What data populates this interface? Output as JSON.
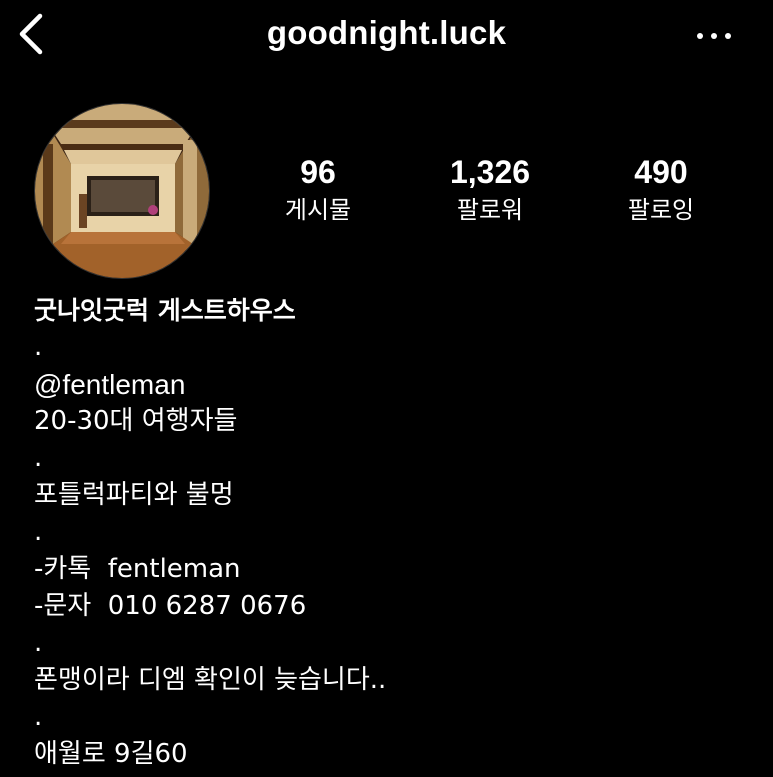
{
  "header": {
    "username": "goodnight.luck",
    "back_icon": "chevron-left-icon",
    "more_icon": "more-horizontal-icon"
  },
  "profile": {
    "avatar_description": "guesthouse interior photo",
    "stats": [
      {
        "value": "96",
        "label": "게시물"
      },
      {
        "value": "1,326",
        "label": "팔로워"
      },
      {
        "value": "490",
        "label": "팔로잉"
      }
    ]
  },
  "bio": {
    "name": "굿나잇굿럭 게스트하우스",
    "lines": [
      ".",
      "@fentleman",
      "20-30대 여행자들",
      ".",
      "포틀럭파티와 불멍",
      ".",
      "-카톡  fentleman",
      "-문자  010 6287 0676",
      ".",
      "폰맹이라 디엠 확인이 늦습니다..",
      ".",
      "애월로 9길60"
    ]
  },
  "colors": {
    "background": "#000000",
    "text": "#ffffff"
  }
}
